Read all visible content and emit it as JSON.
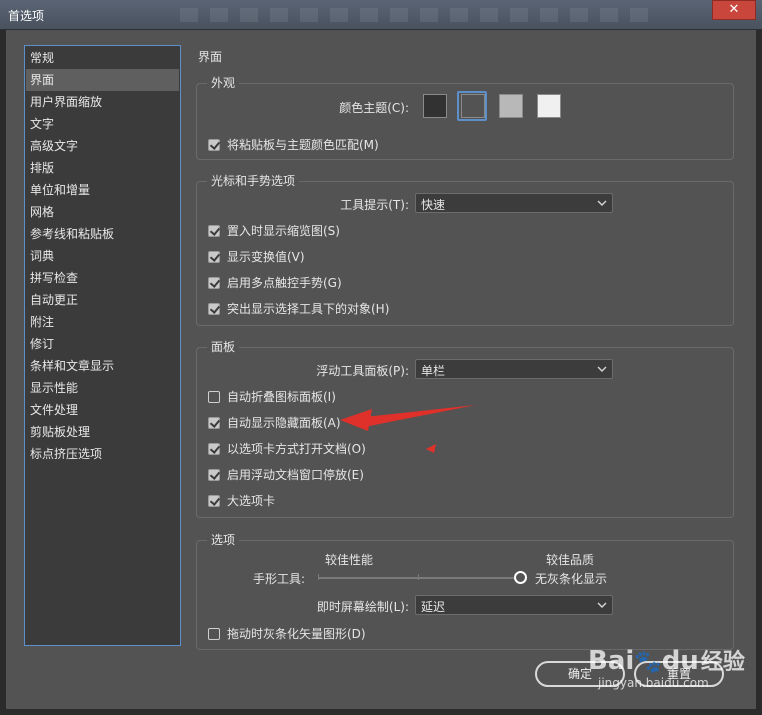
{
  "window": {
    "title": "首选项",
    "close_glyph": "✕"
  },
  "sidebar": {
    "items": [
      {
        "label": "常规",
        "selected": false
      },
      {
        "label": "界面",
        "selected": true
      },
      {
        "label": "用户界面缩放",
        "selected": false
      },
      {
        "label": "文字",
        "selected": false
      },
      {
        "label": "高级文字",
        "selected": false
      },
      {
        "label": "排版",
        "selected": false
      },
      {
        "label": "单位和增量",
        "selected": false
      },
      {
        "label": "网格",
        "selected": false
      },
      {
        "label": "参考线和粘贴板",
        "selected": false
      },
      {
        "label": "词典",
        "selected": false
      },
      {
        "label": "拼写检查",
        "selected": false
      },
      {
        "label": "自动更正",
        "selected": false
      },
      {
        "label": "附注",
        "selected": false
      },
      {
        "label": "修订",
        "selected": false
      },
      {
        "label": "条样和文章显示",
        "selected": false
      },
      {
        "label": "显示性能",
        "selected": false
      },
      {
        "label": "文件处理",
        "selected": false
      },
      {
        "label": "剪贴板处理",
        "selected": false
      },
      {
        "label": "标点挤压选项",
        "selected": false
      }
    ]
  },
  "main": {
    "title": "界面",
    "appearance": {
      "legend": "外观",
      "color_theme_label": "颜色主题(C):",
      "swatches": [
        {
          "name": "dark",
          "color": "#323232",
          "selected": false
        },
        {
          "name": "medium-dark",
          "color": "#535353",
          "selected": true
        },
        {
          "name": "medium-light",
          "color": "#b8b8b8",
          "selected": false
        },
        {
          "name": "light",
          "color": "#f0f0f0",
          "selected": false
        }
      ],
      "match_pasteboard": {
        "label": "将粘贴板与主题颜色匹配(M)",
        "checked": true
      }
    },
    "cursor": {
      "legend": "光标和手势选项",
      "tooltips_label": "工具提示(T):",
      "tooltips_value": "快速",
      "options": [
        {
          "label": "置入时显示缩览图(S)",
          "checked": true
        },
        {
          "label": "显示变换值(V)",
          "checked": true
        },
        {
          "label": "启用多点触控手势(G)",
          "checked": true
        },
        {
          "label": "突出显示选择工具下的对象(H)",
          "checked": true
        }
      ]
    },
    "panels": {
      "legend": "面板",
      "floating_label": "浮动工具面板(P):",
      "floating_value": "单栏",
      "options": [
        {
          "label": "自动折叠图标面板(I)",
          "checked": false
        },
        {
          "label": "自动显示隐藏面板(A)",
          "checked": true
        },
        {
          "label": "以选项卡方式打开文档(O)",
          "checked": true
        },
        {
          "label": "启用浮动文档窗口停放(E)",
          "checked": true
        },
        {
          "label": "大选项卡",
          "checked": true
        }
      ]
    },
    "options": {
      "legend": "选项",
      "better_performance": "较佳性能",
      "better_quality": "较佳品质",
      "hand_tool_label": "手形工具:",
      "hand_tool_value": "无灰条化显示",
      "hand_tool_level": 1.0,
      "live_draw_label": "即时屏幕绘制(L):",
      "live_draw_value": "延迟",
      "gray_vector": {
        "label": "拖动时灰条化矢量图形(D)",
        "checked": false
      }
    }
  },
  "buttons": {
    "ok": "确定",
    "reset": "重置"
  },
  "annotation": {
    "arrow_color": "#e0302a"
  },
  "watermark": {
    "brand": "Bai",
    "paw": "🐾",
    "du": "du",
    "cn": "经验",
    "url": "jingyan.baidu.com"
  }
}
